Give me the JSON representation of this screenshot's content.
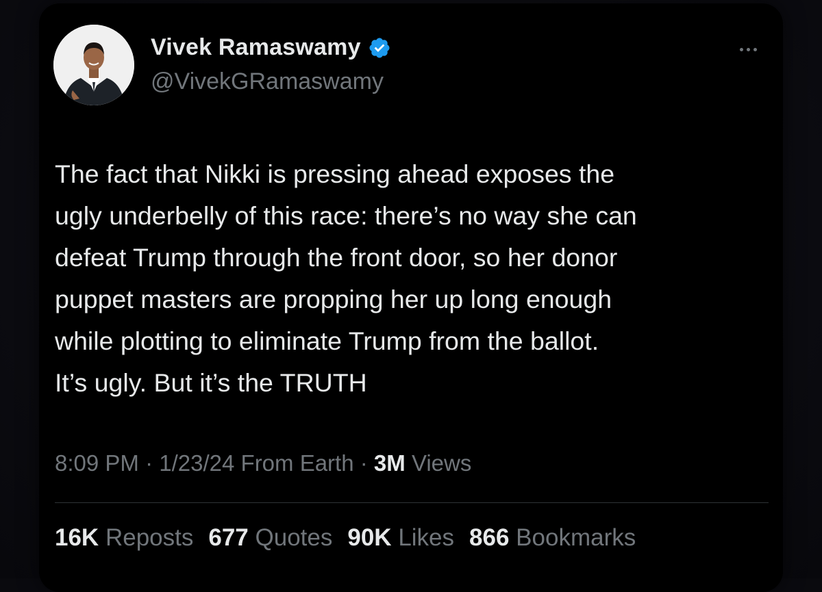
{
  "author": {
    "display_name": "Vivek Ramaswamy",
    "handle": "@VivekGRamaswamy",
    "verified_icon": "verified-badge-icon"
  },
  "tweet": {
    "text": "The fact that Nikki is pressing ahead exposes the\nugly underbelly of this race: there’s no way she can\ndefeat Trump through the front door, so her donor\npuppet masters are propping her up long enough\nwhile plotting to eliminate Trump from the ballot.\nIt’s ugly. But it’s the TRUTH"
  },
  "meta": {
    "time": "8:09 PM",
    "separator": "·",
    "date": "1/23/24",
    "source": "From Earth",
    "views_count": "3M",
    "views_label": "Views"
  },
  "stats": [
    {
      "count": "16K",
      "label": "Reposts"
    },
    {
      "count": "677",
      "label": "Quotes"
    },
    {
      "count": "90K",
      "label": "Likes"
    },
    {
      "count": "866",
      "label": "Bookmarks"
    }
  ],
  "colors": {
    "background": "#000000",
    "text": "#e7e9ea",
    "secondary_text": "#71767b",
    "verified": "#1d9bf0",
    "divider": "#2f3336"
  }
}
